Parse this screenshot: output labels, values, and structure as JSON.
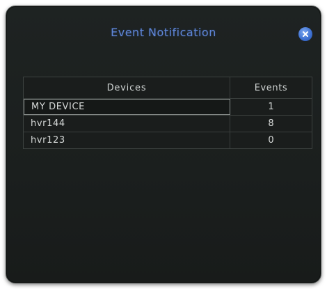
{
  "dialog": {
    "title": "Event Notification",
    "close_icon": "close-icon",
    "accent_color": "#5f86d6"
  },
  "table": {
    "columns": [
      "Devices",
      "Events"
    ],
    "rows": [
      {
        "device": "MY DEVICE",
        "events": "1",
        "selected": true
      },
      {
        "device": "hvr144",
        "events": "8",
        "selected": false
      },
      {
        "device": "hvr123",
        "events": "0",
        "selected": false
      }
    ]
  }
}
